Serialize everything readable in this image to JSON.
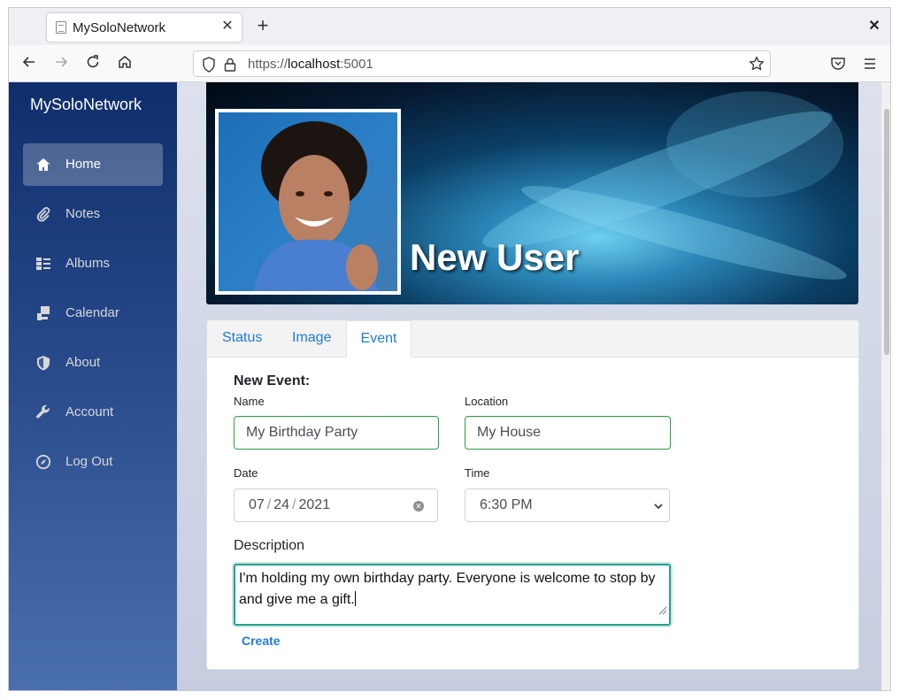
{
  "browser": {
    "tab_title": "MySoloNetwork",
    "url_scheme": "https://",
    "url_host": "localhost",
    "url_port": ":5001"
  },
  "sidebar": {
    "brand": "MySoloNetwork",
    "items": [
      {
        "label": "Home",
        "icon": "home-icon",
        "active": true
      },
      {
        "label": "Notes",
        "icon": "paperclip-icon"
      },
      {
        "label": "Albums",
        "icon": "albums-list-icon"
      },
      {
        "label": "Calendar",
        "icon": "calendar-icon"
      },
      {
        "label": "About",
        "icon": "shield-icon"
      },
      {
        "label": "Account",
        "icon": "wrench-icon"
      },
      {
        "label": "Log Out",
        "icon": "compass-icon"
      }
    ]
  },
  "profile": {
    "name": "New User"
  },
  "tabs": [
    {
      "label": "Status"
    },
    {
      "label": "Image"
    },
    {
      "label": "Event",
      "active": true
    }
  ],
  "event_form": {
    "heading": "New Event:",
    "name_label": "Name",
    "name_value": "My Birthday Party",
    "location_label": "Location",
    "location_value": "My House",
    "date_label": "Date",
    "date_month": "07",
    "date_day": "24",
    "date_year": "2021",
    "time_label": "Time",
    "time_value": "6:30 PM",
    "description_label": "Description",
    "description_value": "I'm holding my own birthday party. Everyone is welcome to stop by and give me a gift.",
    "create_label": "Create"
  },
  "colors": {
    "accent": "#1f7bd6",
    "valid_border": "#26a142",
    "sidebar_top": "#0f2e6b",
    "sidebar_bottom": "#4a6fae"
  }
}
